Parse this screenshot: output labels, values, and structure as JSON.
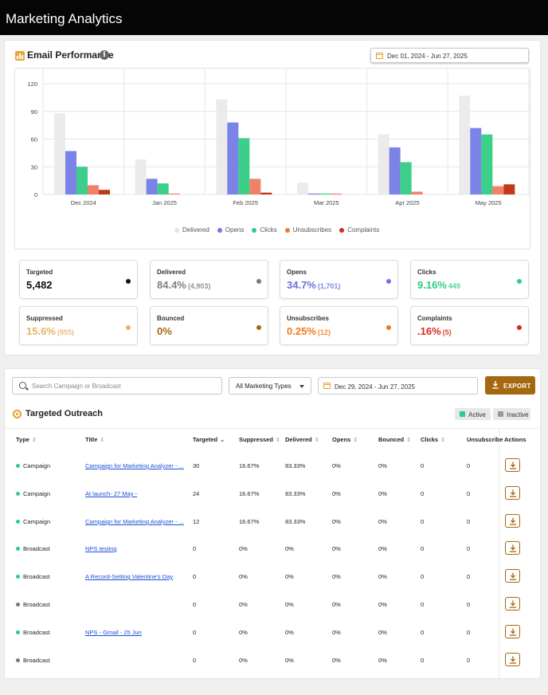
{
  "app": {
    "title": "Marketing Analytics"
  },
  "email_performance": {
    "title": "Email Performance",
    "date_range": "Dec 01, 2024 - Jun 27, 2025"
  },
  "chart_data": {
    "type": "bar",
    "categories": [
      "Dec 2024",
      "Jan 2025",
      "Feb 2025",
      "Mar 2025",
      "Apr 2025",
      "May 2025"
    ],
    "series": [
      {
        "name": "Delivered",
        "color": "#ebebeb",
        "values": [
          88,
          38,
          103,
          13,
          65,
          107
        ]
      },
      {
        "name": "Opens",
        "color": "#7b83e6",
        "values": [
          47,
          17,
          78,
          1,
          51,
          72
        ]
      },
      {
        "name": "Clicks",
        "color": "#3ccf8a",
        "values": [
          30,
          12,
          61,
          1,
          35,
          65
        ]
      },
      {
        "name": "Unsubscribes",
        "color": "#f0826a",
        "values": [
          10,
          1,
          17,
          1,
          3,
          9
        ]
      },
      {
        "name": "Complaints",
        "color": "#c0391b",
        "values": [
          5,
          0,
          2,
          0,
          0,
          11
        ]
      }
    ],
    "legend_colors": [
      "#e3e3e3",
      "#6f78e6",
      "#2ecc85",
      "#ee7a2a",
      "#d22b1a"
    ],
    "ylim": [
      0,
      120
    ],
    "yticks": [
      "0",
      "30",
      "60",
      "90",
      "120"
    ],
    "grid": true,
    "legend": "bottom"
  },
  "stats": [
    {
      "label": "Targeted",
      "value": "5,482",
      "sub": "",
      "color": "#111111",
      "dot": "#111111"
    },
    {
      "label": "Delivered",
      "value": "84.4%",
      "sub": "(4,903)",
      "color": "#808080",
      "dot": "#7a7a7a"
    },
    {
      "label": "Opens",
      "value": "34.7%",
      "sub": "(1,701)",
      "color": "#6a73e0",
      "dot": "#6a73e0"
    },
    {
      "label": "Clicks",
      "value": "9.16%",
      "sub": "449",
      "color": "#2ecc85",
      "dot": "#2ecc85"
    },
    {
      "label": "Suppressed",
      "value": "15.6%",
      "sub": "(855)",
      "color": "#e8b36a",
      "dot": "#e8b36a"
    },
    {
      "label": "Bounced",
      "value": "0%",
      "sub": "",
      "color": "#a5670f",
      "dot": "#a5670f"
    },
    {
      "label": "Unsubscribes",
      "value": "0.25%",
      "sub": "(12)",
      "color": "#ee7a1a",
      "dot": "#ee7a1a"
    },
    {
      "label": "Complaints",
      "value": ".16%",
      "sub": "(5)",
      "color": "#d42a1a",
      "dot": "#d42a1a"
    }
  ],
  "outreach": {
    "search_placeholder": "Search Campaign or Broadcast",
    "type_filter": "All Marketing Types",
    "date_range": "Dec 29, 2024 - Jun 27, 2025",
    "export_label": "EXPORT",
    "title": "Targeted Outreach",
    "active_label": "Active",
    "inactive_label": "Inactive",
    "active_color": "#2ecc85",
    "inactive_color": "#777777",
    "columns": [
      "Type",
      "Title",
      "Targeted",
      "Suppressed",
      "Delivered",
      "Opens",
      "Bounced",
      "Clicks",
      "Unsubscribe",
      "Actions"
    ],
    "rows": [
      {
        "active": true,
        "type": "Campaign",
        "title": "Campaign for Marketing Analyzer - ...",
        "targeted": "30",
        "suppressed": "16.67%",
        "delivered": "83.33%",
        "opens": "0%",
        "bounced": "0%",
        "clicks": "0",
        "unsub": "0"
      },
      {
        "active": true,
        "type": "Campaign",
        "title": "At launch- 27 May -",
        "targeted": "24",
        "suppressed": "16.67%",
        "delivered": "83.33%",
        "opens": "0%",
        "bounced": "0%",
        "clicks": "0",
        "unsub": "0"
      },
      {
        "active": true,
        "type": "Campaign",
        "title": "Campaign for Marketing Analyzer - ...",
        "targeted": "12",
        "suppressed": "16.67%",
        "delivered": "83.33%",
        "opens": "0%",
        "bounced": "0%",
        "clicks": "0",
        "unsub": "0"
      },
      {
        "active": true,
        "type": "Broadcast",
        "title": "NPS testing",
        "targeted": "0",
        "suppressed": "0%",
        "delivered": "0%",
        "opens": "0%",
        "bounced": "0%",
        "clicks": "0",
        "unsub": "0"
      },
      {
        "active": true,
        "type": "Broadcast",
        "title": "A Record-Setting Valentine's Day",
        "targeted": "0",
        "suppressed": "0%",
        "delivered": "0%",
        "opens": "0%",
        "bounced": "0%",
        "clicks": "0",
        "unsub": "0"
      },
      {
        "active": false,
        "type": "Broadcast",
        "title": "",
        "targeted": "0",
        "suppressed": "0%",
        "delivered": "0%",
        "opens": "0%",
        "bounced": "0%",
        "clicks": "0",
        "unsub": "0"
      },
      {
        "active": true,
        "type": "Broadcast",
        "title": "NPS - Gmail - 25 Jun",
        "targeted": "0",
        "suppressed": "0%",
        "delivered": "0%",
        "opens": "0%",
        "bounced": "0%",
        "clicks": "0",
        "unsub": "0"
      },
      {
        "active": false,
        "type": "Broadcast",
        "title": "",
        "targeted": "0",
        "suppressed": "0%",
        "delivered": "0%",
        "opens": "0%",
        "bounced": "0%",
        "clicks": "0",
        "unsub": "0"
      }
    ]
  }
}
